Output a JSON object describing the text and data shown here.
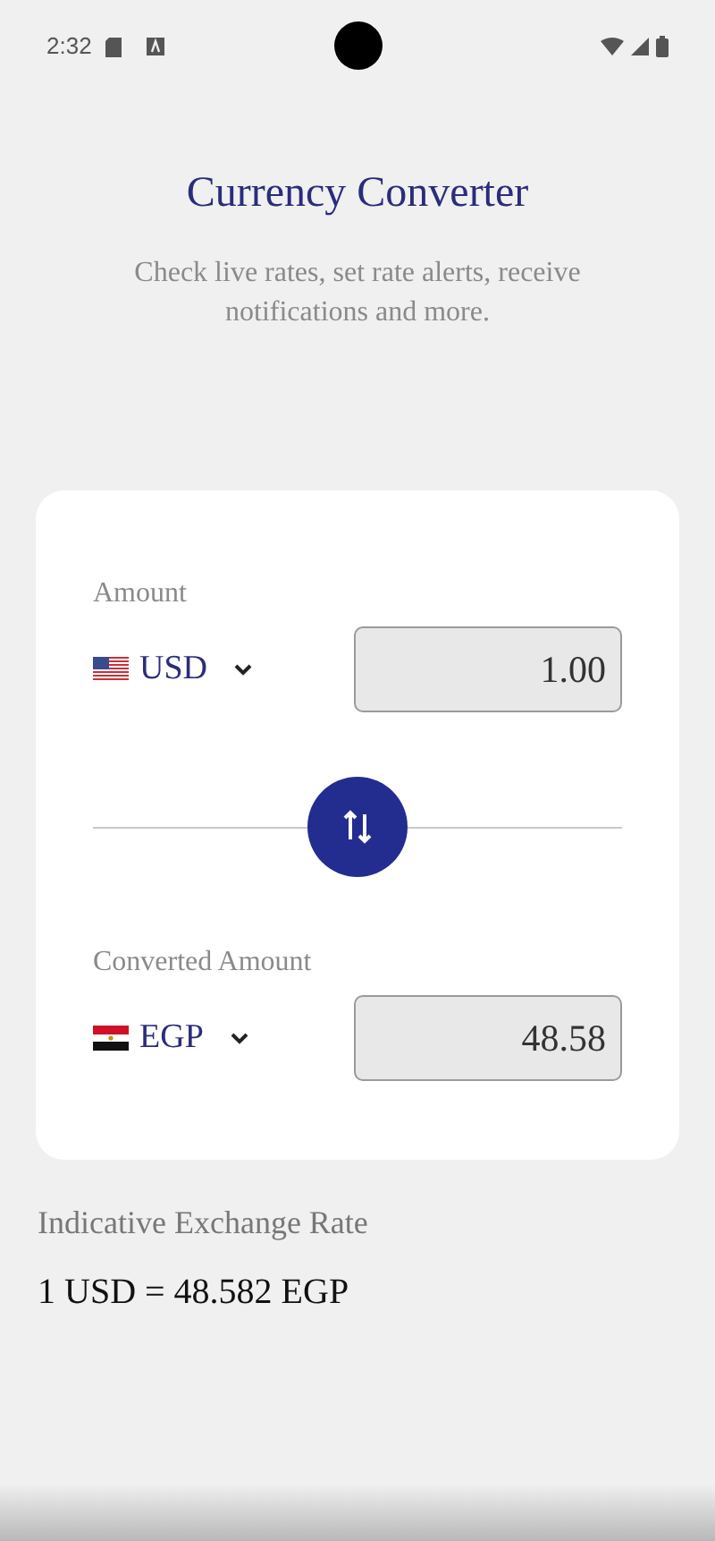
{
  "status_bar": {
    "time": "2:32"
  },
  "header": {
    "title": "Currency Converter",
    "subtitle": "Check live rates, set rate alerts, receive notifications and more."
  },
  "converter": {
    "fields": [
      {
        "label": "Amount",
        "currency": "USD",
        "kind": "us",
        "value": "1.00"
      },
      {
        "label": "Converted Amount",
        "currency": "EGP",
        "kind": "eg",
        "value": "48.58"
      }
    ]
  },
  "rate": {
    "label": "Indicative Exchange Rate",
    "value": "1 USD = 48.582 EGP"
  }
}
